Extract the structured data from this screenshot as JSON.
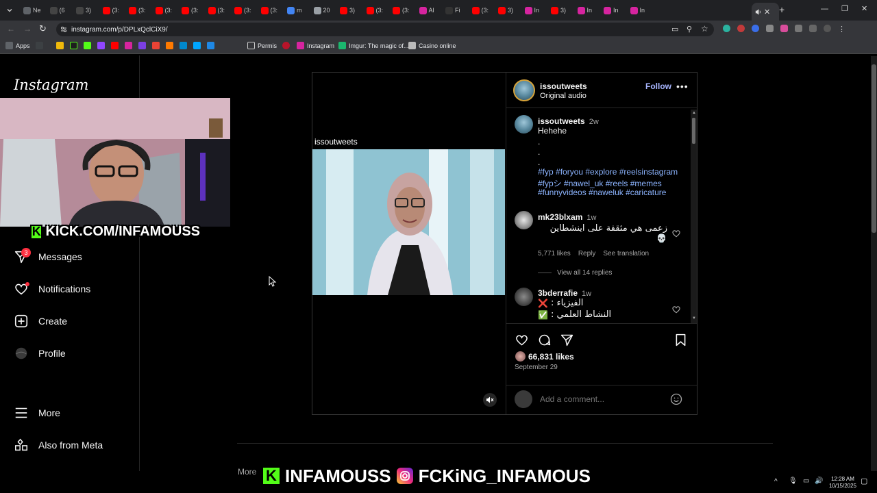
{
  "browser": {
    "url": "instagram.com/p/DPLxQclCiX9/",
    "tab_labels": [
      "Ne",
      "(6",
      "3)",
      "(3:",
      "(3:",
      "(3:",
      "(3:",
      "(3:",
      "(3:",
      "(3:",
      "m",
      "20",
      "3)",
      "(3:",
      "(3:",
      "Al",
      "Fi",
      "(3:",
      "3)",
      "In",
      "3)",
      "In",
      "In",
      "In",
      "In"
    ],
    "bookmarks": {
      "apps": "Apps",
      "permis": "Permis",
      "instagram": "Instagram",
      "imgur": "Imgur: The magic of...",
      "casino": "Casino online"
    }
  },
  "instagram": {
    "logo": "Instagram",
    "nav": {
      "messages": "Messages",
      "messages_badge": "3",
      "notifications": "Notifications",
      "create": "Create",
      "profile": "Profile",
      "more": "More",
      "also_from_meta": "Also from Meta"
    },
    "post": {
      "media_username": "issoutweets",
      "header": {
        "username": "issoutweets",
        "audio": "Original audio",
        "follow": "Follow"
      },
      "caption": {
        "username": "issoutweets",
        "time": "2w",
        "text": "Hehehe",
        "dots": [
          ".",
          ".",
          "."
        ],
        "hashtags": [
          "#fyp #foryou #explore #reelsinstagram",
          "#fypシ #nawel_uk #reels #memes",
          "#funnyvideos #naweluk #caricature"
        ]
      },
      "comments": [
        {
          "username": "mk23blxam",
          "time": "1w",
          "text": "زعمى هي مثقفة على اينشطاين",
          "emoji": "💀",
          "likes": "5,771 likes",
          "reply": "Reply",
          "translate": "See translation",
          "view_replies": "View all 14 replies"
        },
        {
          "username": "3bderrafie",
          "time": "1w",
          "line1": "الفيزياء :",
          "line1_emoji": "❌",
          "line2": "النشاط العلمي :",
          "line2_emoji": "✅"
        }
      ],
      "likes": "66,831 likes",
      "date": "September 29",
      "add_comment_placeholder": "Add a comment...",
      "more_label": "More"
    }
  },
  "stream_overlay": {
    "kick_text": "KICK.COM/INFAMOUSS",
    "banner_kick": "INFAMOUSS",
    "banner_ig": "FCKiNG_INFAMOUS"
  },
  "taskbar": {
    "time": "12:28 AM",
    "date": "10/15/2025"
  },
  "colors": {
    "background": "#000000",
    "follow_blue": "#0095f6",
    "hashtag": "#e0f1ff",
    "badge_red": "#ff3040",
    "kick_green": "#53fc18"
  }
}
